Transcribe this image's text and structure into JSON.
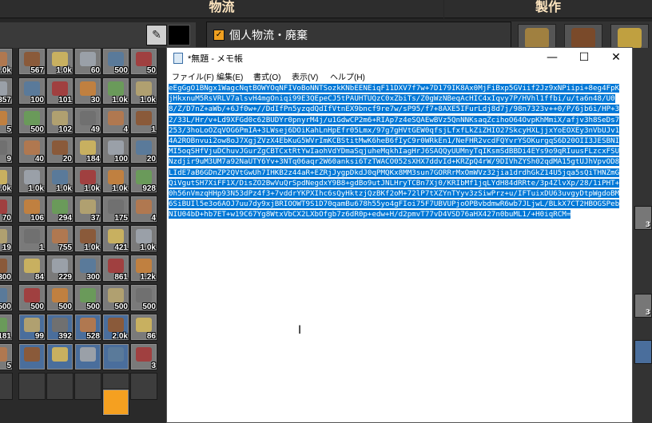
{
  "game": {
    "header_left": "物流",
    "header_right": "製作",
    "logistics_label": "個人物流・廃棄",
    "grid_rows": [
      [
        "1.0k",
        "567",
        "1.0k",
        "60",
        "500",
        "50"
      ],
      [
        "357",
        "100",
        "101",
        "30",
        "1.0k",
        "1.0k"
      ],
      [
        "5",
        "500",
        "102",
        "49",
        "4",
        "1"
      ],
      [
        "9",
        "40",
        "20",
        "184",
        "100",
        "20"
      ],
      [
        "1.0k",
        "1.0k",
        "1.0k",
        "1.0k",
        "1.0k",
        "928"
      ],
      [
        "70",
        "106",
        "294",
        "37",
        "175",
        "4"
      ],
      [
        "19",
        "1",
        "755",
        "1.0k",
        "421",
        "1.0k"
      ],
      [
        "300",
        "84",
        "229",
        "300",
        "861",
        "1.2k"
      ],
      [
        "500",
        "500",
        "500",
        "500",
        "500",
        "500"
      ],
      [
        "181",
        "99",
        "392",
        "528",
        "2.0k",
        "86"
      ],
      [
        "5",
        "",
        "",
        "",
        "",
        "3"
      ]
    ],
    "right_strip": [
      "3",
      "3"
    ]
  },
  "notepad": {
    "title": "*無題 - メモ帳",
    "menu": [
      "ファイル(F)",
      "編集(E)",
      "書式(O)",
      "表示(V)",
      "ヘルプ(H)"
    ],
    "controls": {
      "minimize": "—",
      "maximize": "☐",
      "close": "✕"
    },
    "text": "eEgGgO1BNgx1WagcNqtBOWYOqNFIVoBoNNTSozkKNbEENEiqF11DXV7f7w+7D179IK8Ax0MjFiBxp5GViif2Jz9xNPiipi+8eg4FpKjHkxnuM5RsVRLV7alsvH4mgOniqi99E3QEpeCJ5tPAUHTUQzC0xZbiTs/Z0gWzNBeqAcHIC4xIqvy7P/HVhl1ffbi/u/ta6n48/U08/Z/D7nZ+aWb/+6Jf0w+//DdIfPn5yzqdQdIfVtnEX9bncf9re7w/sP95/f7+8AXE5IFurLdj8d7j/98n7323v++0/P/6jb6i/HP+32/33L/Hr/v+Ld9XFGd0c62BUDYr0pnyrM4j/u1GdwCP2m6+RIAp7z4eSQAEwBVz5QnNNKsaqZcihoO64OvpKhMmiX/afjv3h8SeDs7253/3hoLoOZqVOG6PmIA+3LWsej6DOiKahLnHpEfr05Lmx/97g7gHVtGEW0qfsjLfxfLkZiZHIO27SkcyHXLjjxYoEOXEy3nVbUJv14A2ROBnvui2ow8oJ7XgjZVzX4EbKuG5WVrImKCBStitMwK6heB6fIyC9r0WRkEn1/NeFHR2vcdFQYvrYSOKurgqS6D20OII3JESBNIMI5oqSHfVjuDChuvJGurZgCBTCxtRtYwIaohVdYDmaSqjuheMqkhIagHrJ6SAQQyUUMnyTqIKsmSdBBDi4EYs9o9qRIuusFLzcxFSUNzdjir9uM3UM7a92NaUTY6Yv+3NTq06aqr2W60anksi6TzTWACO052sXHX7ddvId+KRZpQ4rW/9DIVhZYSh02qdMA15gtUJhVpvOD8LIdE7aB6GDnZP2QVtGwUh7IHKB2z44aR+EZRjJygpDkdJ0qPMQKx8MM3sun7GORRrMxOmWVz32jia1drdhGkZ14U5jqa5sQiTHNZmGQiVgutSH7XiFF1X/DisZO2BwVuQrSpdNegdxY9B8+gdBo9utJNLHryTCBn7Xj0/KRIbMf1jqLYdH84dRRte/3p4ZlvXp/28/1iPHT+0h56nVmzqHHp93N53dPz4f3+7vddrYKPXIhc6sQyHktzjQzBKf2oM+72lP7tXZYnTYyv3zSiwPrz+u/IFTuixDU63uvgyDtpWgdoBM6SiBUIl5e3o6AOJ7uu7dy9xjBRIOOWT9S1D70qamBu678h55yo4gFIoi75F7UBVUPjoOPBvbdmwR6wb7JLjwL/BLkX7CT2HBOGSPebNIU04bD+hb7ET+w19C67Yg8WtxVbCX2LXbOfgb7z6dR0p+edw+H/d2pmvT77vD4VSD76aHX427n0buML1/+H0iqRCM="
  }
}
